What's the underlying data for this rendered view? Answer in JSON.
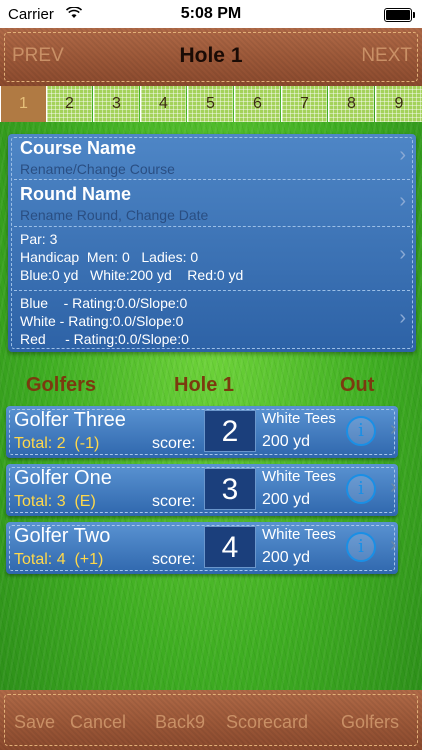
{
  "status": {
    "carrier": "Carrier",
    "time": "5:08 PM"
  },
  "header": {
    "prev": "PREV",
    "title": "Hole 1",
    "next": "NEXT"
  },
  "holes": [
    "1",
    "2",
    "3",
    "4",
    "5",
    "6",
    "7",
    "8",
    "9"
  ],
  "active_hole": "1",
  "course": {
    "title": "Course Name",
    "subtitle": "Rename/Change Course"
  },
  "round": {
    "title": "Round Name",
    "subtitle": "Rename Round, Change Date"
  },
  "hole_info": {
    "par": "Par: 3",
    "handicap": "Handicap  Men: 0   Ladies: 0",
    "yardage": "Blue:0 yd   White:200 yd    Red:0 yd"
  },
  "ratings": {
    "blue": "Blue    - Rating:0.0/Slope:0",
    "white": "White - Rating:0.0/Slope:0",
    "red": "Red     - Rating:0.0/Slope:0"
  },
  "section": {
    "golfers": "Golfers",
    "hole": "Hole 1",
    "out": "Out"
  },
  "score_label": "score:",
  "golfers": [
    {
      "name": "Golfer Three",
      "total": "Total: 2  (-1)",
      "score": "2",
      "tees": "White Tees",
      "yardage": "200 yd"
    },
    {
      "name": "Golfer One",
      "total": "Total: 3  (E)",
      "score": "3",
      "tees": "White Tees",
      "yardage": "200 yd"
    },
    {
      "name": "Golfer Two",
      "total": "Total: 4  (+1)",
      "score": "4",
      "tees": "White Tees",
      "yardage": "200 yd"
    }
  ],
  "footer": {
    "save": "Save",
    "cancel": "Cancel",
    "back9": "Back9",
    "scorecard": "Scorecard",
    "golfers": "Golfers"
  },
  "colors": {
    "card_blue": "#3a72b8",
    "leather": "#9d5939",
    "grass": "#4cbb2a",
    "total_yellow": "#ffd84a",
    "section_brown": "#7b3a0f"
  }
}
